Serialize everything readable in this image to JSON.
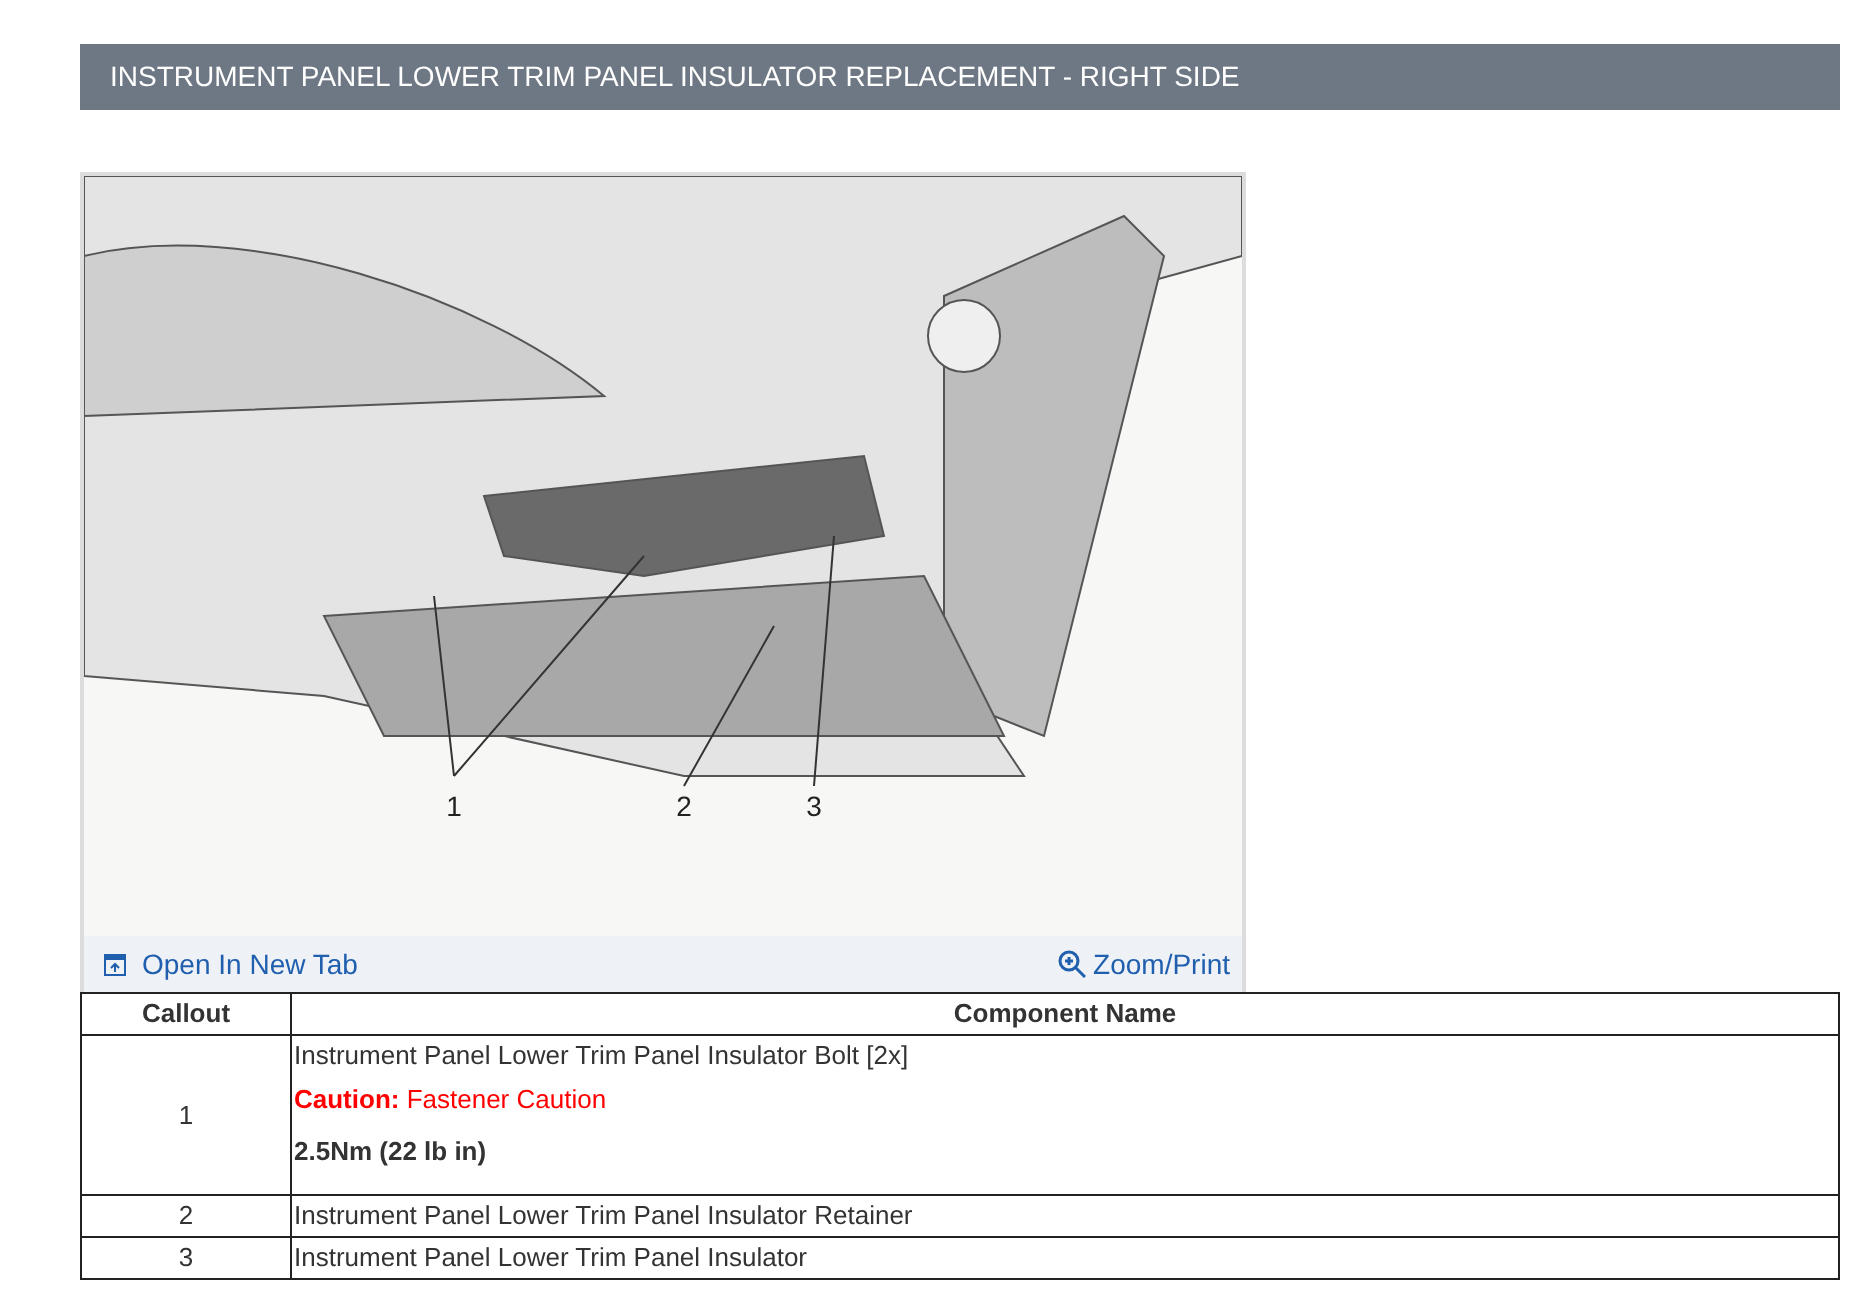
{
  "section_title": "INSTRUMENT PANEL LOWER TRIM PANEL INSULATOR REPLACEMENT - RIGHT SIDE",
  "figure": {
    "callouts": [
      "1",
      "2",
      "3"
    ],
    "open_link": "Open In New Tab",
    "zoom_link": "Zoom/Print"
  },
  "table": {
    "columns": [
      "Callout",
      "Component Name"
    ],
    "rows": [
      {
        "callout": "1",
        "name": "Instrument Panel Lower Trim Panel Insulator Bolt [2x]",
        "caution_label": "Caution:",
        "caution_text": "Fastener Caution",
        "torque": "2.5Nm (22 lb in)"
      },
      {
        "callout": "2",
        "name": "Instrument Panel Lower Trim Panel Insulator Retainer"
      },
      {
        "callout": "3",
        "name": "Instrument Panel Lower Trim Panel Insulator"
      }
    ]
  }
}
